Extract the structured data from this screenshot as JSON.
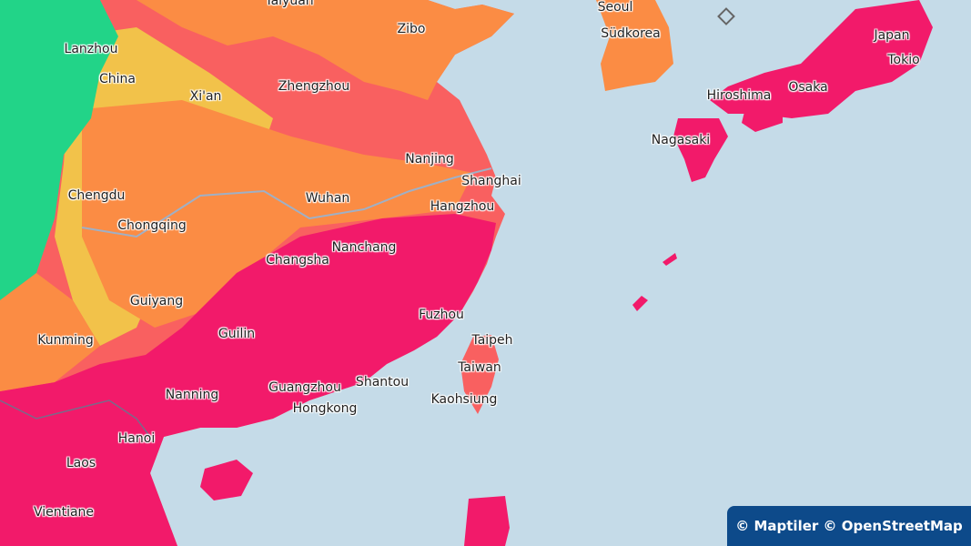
{
  "map": {
    "labels": [
      {
        "id": "taiyuan",
        "text": "Taiyuan"
      },
      {
        "id": "seoul",
        "text": "Seoul"
      },
      {
        "id": "zibo",
        "text": "Zibo"
      },
      {
        "id": "sudkorea",
        "text": "Südkorea"
      },
      {
        "id": "japan",
        "text": "Japan"
      },
      {
        "id": "tokio",
        "text": "Tokio"
      },
      {
        "id": "lanzhou",
        "text": "Lanzhou"
      },
      {
        "id": "china",
        "text": "China"
      },
      {
        "id": "zhengzhou",
        "text": "Zhengzhou"
      },
      {
        "id": "xian",
        "text": "Xi'an"
      },
      {
        "id": "hiroshima",
        "text": "Hiroshima"
      },
      {
        "id": "osaka",
        "text": "Osaka"
      },
      {
        "id": "nagasaki",
        "text": "Nagasaki"
      },
      {
        "id": "nanjing",
        "text": "Nanjing"
      },
      {
        "id": "shanghai",
        "text": "Shanghai"
      },
      {
        "id": "chengdu",
        "text": "Chengdu"
      },
      {
        "id": "wuhan",
        "text": "Wuhan"
      },
      {
        "id": "hangzhou",
        "text": "Hangzhou"
      },
      {
        "id": "chongqing",
        "text": "Chongqing"
      },
      {
        "id": "nanchang",
        "text": "Nanchang"
      },
      {
        "id": "changsha",
        "text": "Changsha"
      },
      {
        "id": "guiyang",
        "text": "Guiyang"
      },
      {
        "id": "fuzhou",
        "text": "Fuzhou"
      },
      {
        "id": "guilin",
        "text": "Guilin"
      },
      {
        "id": "kunming",
        "text": "Kunming"
      },
      {
        "id": "taipeh",
        "text": "Taipeh"
      },
      {
        "id": "taiwan",
        "text": "Taiwan"
      },
      {
        "id": "shantou",
        "text": "Shantou"
      },
      {
        "id": "guangzhou",
        "text": "Guangzhou"
      },
      {
        "id": "nanning",
        "text": "Nanning"
      },
      {
        "id": "kaohsiung",
        "text": "Kaohsiung"
      },
      {
        "id": "hongkong",
        "text": "Hongkong"
      },
      {
        "id": "hanoi",
        "text": "Hanoi"
      },
      {
        "id": "laos",
        "text": "Laos"
      },
      {
        "id": "vientiane",
        "text": "Vientiane"
      }
    ],
    "attribution": "© Maptiler © OpenStreetMap",
    "colors": {
      "sea": "#c5dbe8",
      "green": "#22d488",
      "yellow": "#f2c24a",
      "orange": "#fb8c44",
      "red": "#f96060",
      "magenta": "#f21a6a"
    }
  }
}
